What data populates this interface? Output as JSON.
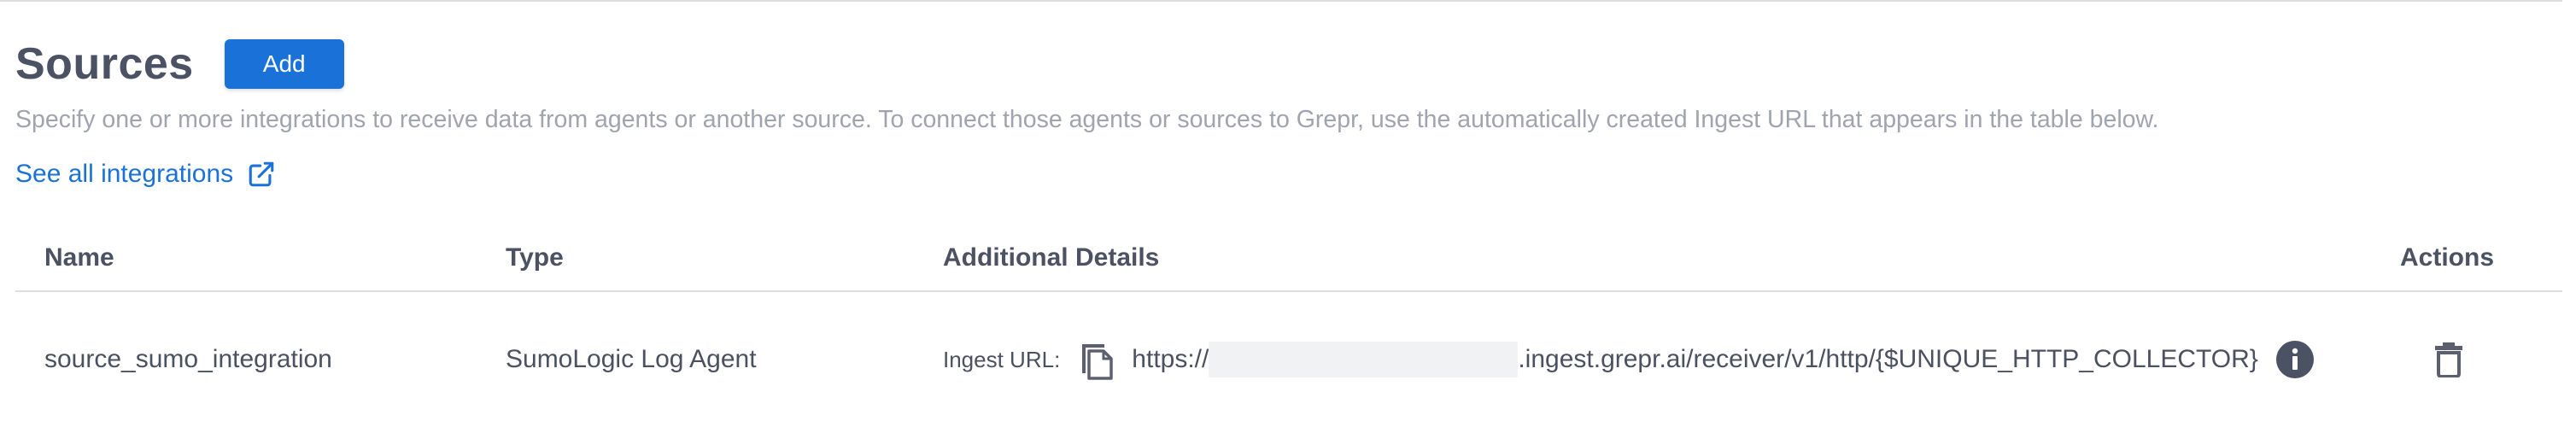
{
  "header": {
    "title": "Sources",
    "add_label": "Add"
  },
  "description": "Specify one or more integrations to receive data from agents or another source. To connect those agents or sources to Grepr, use the automatically created Ingest URL that appears in the table below.",
  "integrations_link": {
    "label": "See all integrations",
    "icon": "external-link-icon"
  },
  "table": {
    "columns": {
      "name": "Name",
      "type": "Type",
      "details": "Additional Details",
      "actions": "Actions"
    },
    "rows": [
      {
        "name": "source_sumo_integration",
        "type": "SumoLogic Log Agent",
        "ingest_label": "Ingest URL:",
        "url_prefix": "https://",
        "url_suffix": ".ingest.grepr.ai/receiver/v1/http/{$UNIQUE_HTTP_COLLECTOR}",
        "copy_icon": "copy-icon",
        "info_icon": "info-icon",
        "delete_icon": "trash-icon"
      }
    ]
  },
  "colors": {
    "accent": "#1a72d8",
    "heading": "#4b5263",
    "muted": "#9fa4ae",
    "border": "#dcdde2"
  }
}
